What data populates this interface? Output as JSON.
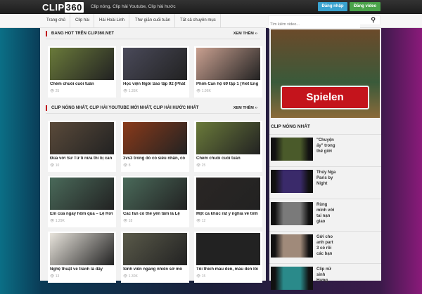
{
  "header": {
    "logo_a": "CLIP",
    "logo_b": "360",
    "tagline": "Clip nóng, Clip hài Youtube, Clip hài hước",
    "login": "Đăng nhập",
    "upload": "Đăng video"
  },
  "nav": {
    "items": [
      "Trang chủ",
      "Clip hài",
      "Hài Hoài Linh",
      "Thư giãn cuối tuần",
      "Tất cả chuyên mục"
    ],
    "search_placeholder": "Tìm kiếm video...",
    "search_icon": "magnifier"
  },
  "sections": [
    {
      "title": "ĐANG HOT TRÊN CLIP360.NET",
      "more": "XEM THÊM ››",
      "cards": [
        {
          "title": "Chém chuối cuối tuần",
          "views": "25",
          "color": "#6a7a3a"
        },
        {
          "title": "Học viện Ngôi Sao tập 92 (Phát",
          "views": "1.35K",
          "color": "#4a4a5a"
        },
        {
          "title": "Phim Căn hộ 69 tập 1 (Viet Eng",
          "views": "1.96K",
          "color": "#c9a090"
        }
      ]
    },
    {
      "title": "CLIP NÓNG NHẤT, CLIP HÀI YOUTUBE MỚI NHẤT, CLIP HÀI HƯỚC NHẤT",
      "more": "XEM THÊM ››",
      "cards": [
        {
          "title": "Đùa với Sư Tử ti nữa thì bị cắn",
          "views": "10",
          "color": "#5a4a3a"
        },
        {
          "title": "3vs3 trong đó có siêu nhân, có",
          "views": "8",
          "color": "#8a3a1a"
        },
        {
          "title": "Chém chuối cuối tuần",
          "views": "25",
          "color": "#6a7a3a"
        },
        {
          "title": "Em của ngày hôm qua – Lệ Rơi",
          "views": "1.29K",
          "color": "#4a6a5a"
        },
        {
          "title": "Các fan có thể yên tâm là Lệ",
          "views": "18",
          "color": "#4a6a5a"
        },
        {
          "title": "Một ca khúc rất ý nghĩa về tình",
          "views": "12",
          "color": "#2a2624"
        },
        {
          "title": "Nghệ thuật vẽ tranh là đây",
          "views": "13",
          "color": "#e8e4dc"
        },
        {
          "title": "Sinh viên ngang nhiên sờ mó",
          "views": "1.30K",
          "color": "#5a5a4a"
        },
        {
          "title": "Tôi thích màu đen, màu đen lôi",
          "views": "15",
          "color": "#222"
        }
      ]
    }
  ],
  "sidebar": {
    "ad_label": "Spielen",
    "title": "CLIP NÓNG NHẤT",
    "items": [
      {
        "title": "\"Chuyện ấy\" trong thế giới",
        "color": "#4a5a2a"
      },
      {
        "title": "Thúy Nga Paris by Night",
        "color": "#3a2a6a"
      },
      {
        "title": "Rùng mình với tai nạn giao",
        "color": "#7a7a7a"
      },
      {
        "title": "Gửi cho anh part 3 có rồi các bạn",
        "color": "#a08a7a"
      },
      {
        "title": "Clip nữ sinh Hưng",
        "color": "#2a8a8a"
      }
    ]
  }
}
